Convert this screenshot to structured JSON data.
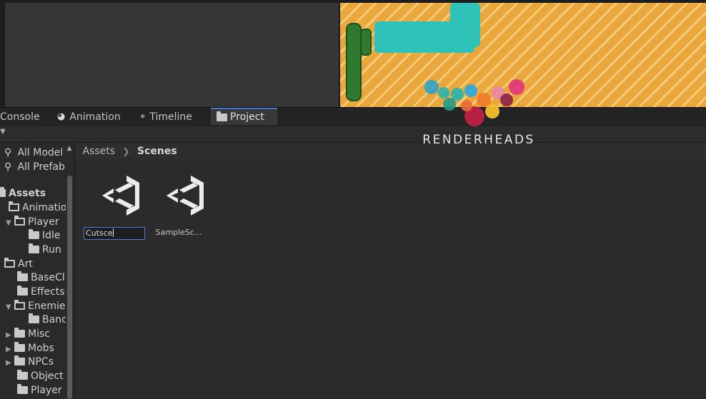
{
  "tabs": [
    {
      "label": "Console",
      "icon": "console-icon"
    },
    {
      "label": "Animation",
      "icon": "animation-icon"
    },
    {
      "label": "Timeline",
      "icon": "timeline-icon"
    },
    {
      "label": "Project",
      "icon": "folder-icon",
      "active": true
    }
  ],
  "favorites": [
    {
      "label": "All Model",
      "icon": "search-icon"
    },
    {
      "label": "All Prefab",
      "icon": "search-icon"
    }
  ],
  "tree": [
    {
      "label": "Assets",
      "bold": true
    },
    {
      "label": "Animation"
    },
    {
      "label": "Player",
      "expanded": true
    },
    {
      "label": "Idle"
    },
    {
      "label": "Run"
    },
    {
      "label": "Art"
    },
    {
      "label": "BaseCl"
    },
    {
      "label": "Effects"
    },
    {
      "label": "Enemie",
      "expanded": true
    },
    {
      "label": "Banc"
    },
    {
      "label": "Misc"
    },
    {
      "label": "Mobs"
    },
    {
      "label": "NPCs"
    },
    {
      "label": "Object"
    },
    {
      "label": "Player"
    }
  ],
  "breadcrumb": [
    "Assets",
    "Scenes"
  ],
  "assets": [
    {
      "name": "Cutsce",
      "icon": "unity-scene-icon",
      "editing": true
    },
    {
      "name": "SampleSc...",
      "icon": "unity-scene-icon",
      "editing": false
    }
  ],
  "watermark": {
    "text": "RENDERHEADS",
    "colors": [
      "#2fa3c9",
      "#27b5ae",
      "#1f9c86",
      "#ef7a2a",
      "#f3c02d",
      "#e23a78",
      "#c02045",
      "#8e1f4a"
    ]
  }
}
